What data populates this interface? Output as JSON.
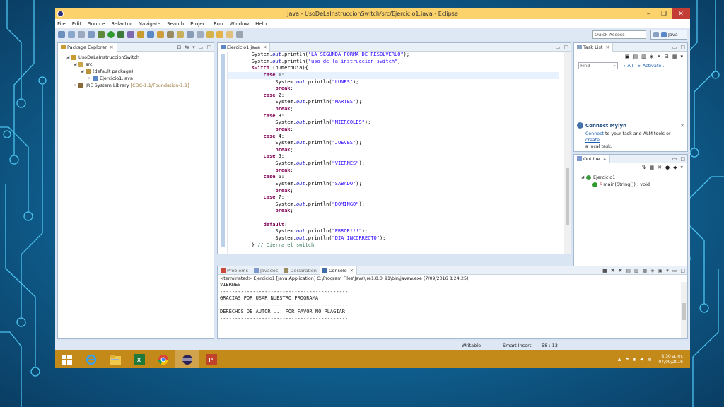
{
  "window": {
    "title": "Java - UsoDeLaInstruccionSwitch/src/Ejercicio1.java - Eclipse",
    "controls": [
      "–",
      "❐",
      "✕"
    ]
  },
  "menu": [
    "File",
    "Edit",
    "Source",
    "Refactor",
    "Navigate",
    "Search",
    "Project",
    "Run",
    "Window",
    "Help"
  ],
  "toolbar": {
    "quick_access": "Quick Access",
    "perspective": "Java"
  },
  "package_explorer": {
    "tab": "Package Explorer",
    "tree": [
      {
        "label": "UsoDeLaInstruccionSwitch",
        "indent": 0,
        "twisty": "◢",
        "icon": "project-icon",
        "deco": ""
      },
      {
        "label": "src",
        "indent": 1,
        "twisty": "◢",
        "icon": "source-folder-icon",
        "deco": ""
      },
      {
        "label": "(default package)",
        "indent": 2,
        "twisty": "◢",
        "icon": "package-icon",
        "deco": ""
      },
      {
        "label": "Ejercicio1.java",
        "indent": 3,
        "twisty": "▷",
        "icon": "java-file-icon",
        "deco": ""
      },
      {
        "label": "JRE System Library",
        "indent": 1,
        "twisty": "▷",
        "icon": "library-icon",
        "deco": "[CDC-1.1/Foundation-1.1]"
      }
    ]
  },
  "editor": {
    "tab": "Ejercicio1.java",
    "lines": [
      [
        {
          "t": "        System.",
          "c": ""
        },
        {
          "t": "out",
          "c": "fld"
        },
        {
          "t": ".println(",
          "c": ""
        },
        {
          "t": "\"LA SEGUNDA FORMA DE RESOLVERLO\"",
          "c": "str"
        },
        {
          "t": ");",
          "c": ""
        }
      ],
      [
        {
          "t": "        System.",
          "c": ""
        },
        {
          "t": "out",
          "c": "fld"
        },
        {
          "t": ".println(",
          "c": ""
        },
        {
          "t": "\"uso de la instruccion switch\"",
          "c": "str"
        },
        {
          "t": ");",
          "c": ""
        }
      ],
      [
        {
          "t": "        ",
          "c": ""
        },
        {
          "t": "switch",
          "c": "kw"
        },
        {
          "t": " (numeroDia){",
          "c": ""
        }
      ],
      [
        {
          "t": "            ",
          "c": ""
        },
        {
          "t": "case",
          "c": "kw"
        },
        {
          "t": " 1:",
          "c": ""
        }
      ],
      [
        {
          "t": "                System.",
          "c": ""
        },
        {
          "t": "out",
          "c": "fld"
        },
        {
          "t": ".println(",
          "c": ""
        },
        {
          "t": "\"LUNES\"",
          "c": "str"
        },
        {
          "t": ");",
          "c": ""
        }
      ],
      [
        {
          "t": "                ",
          "c": ""
        },
        {
          "t": "break",
          "c": "kw"
        },
        {
          "t": ";",
          "c": ""
        }
      ],
      [
        {
          "t": "            ",
          "c": ""
        },
        {
          "t": "case",
          "c": "kw"
        },
        {
          "t": " 2:",
          "c": ""
        }
      ],
      [
        {
          "t": "                System.",
          "c": ""
        },
        {
          "t": "out",
          "c": "fld"
        },
        {
          "t": ".println(",
          "c": ""
        },
        {
          "t": "\"MARTES\"",
          "c": "str"
        },
        {
          "t": ");",
          "c": ""
        }
      ],
      [
        {
          "t": "                ",
          "c": ""
        },
        {
          "t": "break",
          "c": "kw"
        },
        {
          "t": ";",
          "c": ""
        }
      ],
      [
        {
          "t": "            ",
          "c": ""
        },
        {
          "t": "case",
          "c": "kw"
        },
        {
          "t": " 3:",
          "c": ""
        }
      ],
      [
        {
          "t": "                System.",
          "c": ""
        },
        {
          "t": "out",
          "c": "fld"
        },
        {
          "t": ".println(",
          "c": ""
        },
        {
          "t": "\"MIERCOLES\"",
          "c": "str"
        },
        {
          "t": ");",
          "c": ""
        }
      ],
      [
        {
          "t": "                ",
          "c": ""
        },
        {
          "t": "break",
          "c": "kw"
        },
        {
          "t": ";",
          "c": ""
        }
      ],
      [
        {
          "t": "            ",
          "c": ""
        },
        {
          "t": "case",
          "c": "kw"
        },
        {
          "t": " 4:",
          "c": ""
        }
      ],
      [
        {
          "t": "                System.",
          "c": ""
        },
        {
          "t": "out",
          "c": "fld"
        },
        {
          "t": ".println(",
          "c": ""
        },
        {
          "t": "\"JUEVES\"",
          "c": "str"
        },
        {
          "t": ");",
          "c": ""
        }
      ],
      [
        {
          "t": "                ",
          "c": ""
        },
        {
          "t": "break",
          "c": "kw"
        },
        {
          "t": ";",
          "c": ""
        }
      ],
      [
        {
          "t": "            ",
          "c": ""
        },
        {
          "t": "case",
          "c": "kw"
        },
        {
          "t": " 5:",
          "c": ""
        }
      ],
      [
        {
          "t": "                System.",
          "c": ""
        },
        {
          "t": "out",
          "c": "fld"
        },
        {
          "t": ".println(",
          "c": ""
        },
        {
          "t": "\"VIERNES\"",
          "c": "str"
        },
        {
          "t": ");",
          "c": ""
        }
      ],
      [
        {
          "t": "                ",
          "c": ""
        },
        {
          "t": "break",
          "c": "kw"
        },
        {
          "t": ";",
          "c": ""
        }
      ],
      [
        {
          "t": "            ",
          "c": ""
        },
        {
          "t": "case",
          "c": "kw"
        },
        {
          "t": " 6:",
          "c": ""
        }
      ],
      [
        {
          "t": "                System.",
          "c": ""
        },
        {
          "t": "out",
          "c": "fld"
        },
        {
          "t": ".println(",
          "c": ""
        },
        {
          "t": "\"SABADO\"",
          "c": "str"
        },
        {
          "t": ");",
          "c": ""
        }
      ],
      [
        {
          "t": "                ",
          "c": ""
        },
        {
          "t": "break",
          "c": "kw"
        },
        {
          "t": ";",
          "c": ""
        }
      ],
      [
        {
          "t": "            ",
          "c": ""
        },
        {
          "t": "case",
          "c": "kw"
        },
        {
          "t": " 7:",
          "c": ""
        }
      ],
      [
        {
          "t": "                System.",
          "c": ""
        },
        {
          "t": "out",
          "c": "fld"
        },
        {
          "t": ".println(",
          "c": ""
        },
        {
          "t": "\"DOMINGO\"",
          "c": "str"
        },
        {
          "t": ");",
          "c": ""
        }
      ],
      [
        {
          "t": "                ",
          "c": ""
        },
        {
          "t": "break",
          "c": "kw"
        },
        {
          "t": ";",
          "c": ""
        }
      ],
      [
        {
          "t": "",
          "c": ""
        }
      ],
      [
        {
          "t": "            ",
          "c": ""
        },
        {
          "t": "default",
          "c": "kw"
        },
        {
          "t": ":",
          "c": ""
        }
      ],
      [
        {
          "t": "                System.",
          "c": ""
        },
        {
          "t": "out",
          "c": "fld"
        },
        {
          "t": ".println(",
          "c": ""
        },
        {
          "t": "\"ERROR!!!\"",
          "c": "str"
        },
        {
          "t": ");",
          "c": ""
        }
      ],
      [
        {
          "t": "                System.",
          "c": ""
        },
        {
          "t": "out",
          "c": "fld"
        },
        {
          "t": ".println(",
          "c": ""
        },
        {
          "t": "\"DIA INCORRECTO\"",
          "c": "str"
        },
        {
          "t": ");",
          "c": ""
        }
      ],
      [
        {
          "t": "        } ",
          "c": ""
        },
        {
          "t": "// Cierra el switch",
          "c": "cmt"
        }
      ]
    ],
    "highlighted_line": 3
  },
  "task_list": {
    "tab": "Task List",
    "find_placeholder": "Find",
    "all": "All",
    "activate": "Activate..."
  },
  "mylyn": {
    "title": "Connect Mylyn",
    "connect": "Connect",
    "text_mid": " to your task and ALM tools or ",
    "create": "create",
    "text_end": "a local task."
  },
  "outline": {
    "tab": "Outline",
    "class_name": "Ejercicio1",
    "method": "main(String[]) : void",
    "static_marker": "S"
  },
  "bottom_tabs": [
    "Problems",
    "Javadoc",
    "Declaration",
    "Console"
  ],
  "console": {
    "header": "<terminated> Ejercicio1 [Java Application] C:\\Program Files\\Java\\jre1.8.0_91\\bin\\javaw.exe (7/09/2016 8:24:25)",
    "lines": [
      "VIERNES",
      "-------------------------------------------",
      "GRACIAS POR USAR NUESTRO PROGRAMA",
      "-------------------------------------------",
      "DERECHOS DE AUTOR ... POR FAVOR NO PLAGIAR",
      "-------------------------------------------"
    ]
  },
  "status": {
    "writable": "Writable",
    "insert_mode": "Smart Insert",
    "position": "58 : 13"
  },
  "taskbar": {
    "apps": [
      "start-button",
      "internet-explorer-icon",
      "file-explorer-icon",
      "excel-icon",
      "chrome-icon",
      "eclipse-icon",
      "powerpoint-icon"
    ],
    "time": "8:30 a. m.",
    "date": "07/09/2016"
  },
  "colors": {
    "titlebar": "#fbd26b",
    "taskbar": "#c38a1a",
    "keyword": "#7f0055",
    "string": "#2a00ff",
    "field": "#0000c0",
    "comment": "#3f7f5f"
  }
}
